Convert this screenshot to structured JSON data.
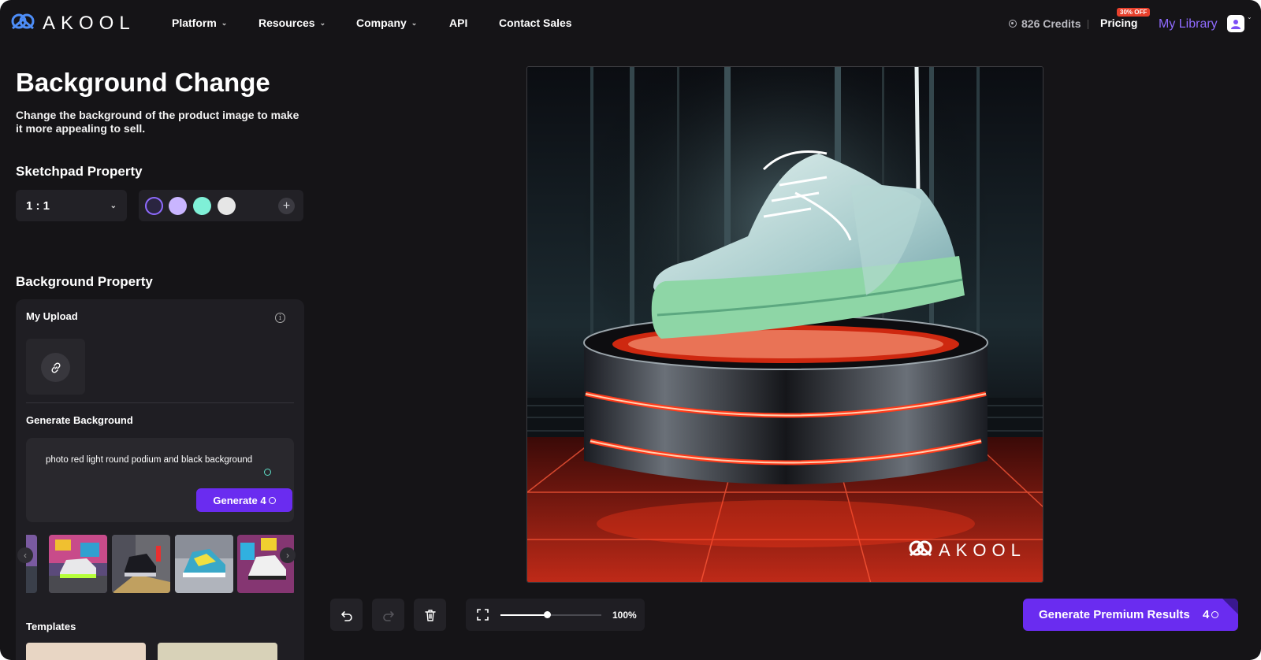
{
  "brand": {
    "name": "AKOOL"
  },
  "nav": {
    "items": [
      {
        "label": "Platform",
        "has_menu": true
      },
      {
        "label": "Resources",
        "has_menu": true
      },
      {
        "label": "Company",
        "has_menu": true
      },
      {
        "label": "API",
        "has_menu": false
      },
      {
        "label": "Contact Sales",
        "has_menu": false
      }
    ],
    "credits": "826 Credits",
    "pricing": "Pricing",
    "pricing_badge": "30% OFF",
    "my_library": "My Library"
  },
  "page": {
    "title": "Background Change",
    "subtitle": "Change the background of the product image to make it more appealing to sell."
  },
  "sketchpad": {
    "heading": "Sketchpad Property",
    "ratio": "1 : 1",
    "swatches": [
      "#2a2540",
      "#c9b5ff",
      "#7ff0d7",
      "#e6e6e6"
    ],
    "add_label": "+"
  },
  "background": {
    "heading": "Background Property",
    "upload_label": "My Upload",
    "generate_label": "Generate Background",
    "prompt": "photo red light round podium and black background",
    "generate_button": "Generate 4",
    "templates_label": "Templates"
  },
  "canvas": {
    "watermark": "AKOOL"
  },
  "toolbar": {
    "zoom": "100%",
    "zoom_fraction": 0.46,
    "premium_label": "Generate Premium Results",
    "premium_count": "4"
  },
  "colors": {
    "accent": "#6a2cf0",
    "link": "#8f6bff",
    "badge": "#e8412d",
    "bg": "#151417"
  }
}
